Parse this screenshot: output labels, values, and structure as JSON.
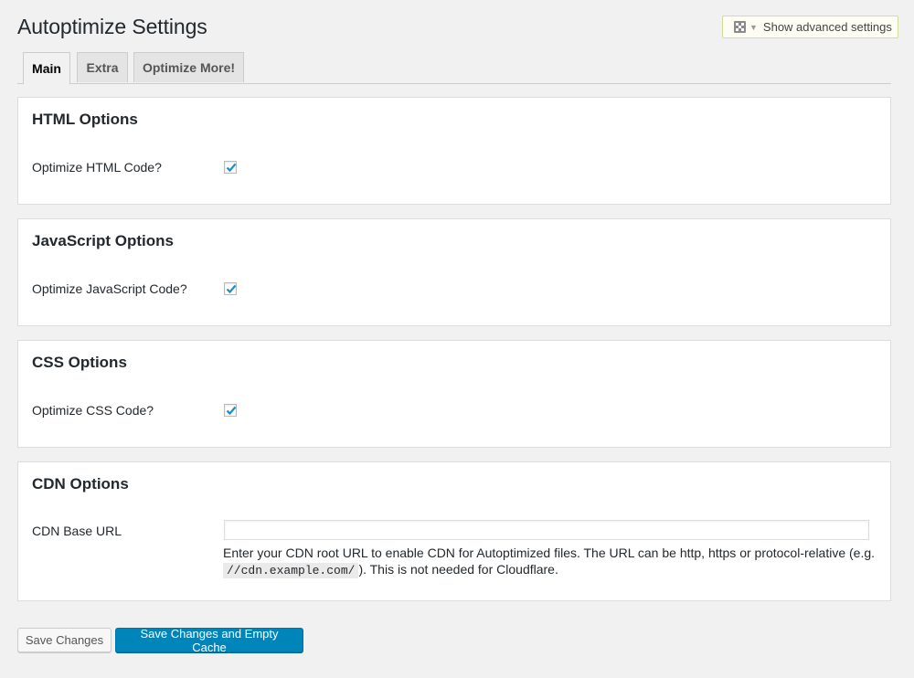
{
  "page": {
    "title": "Autoptimize Settings"
  },
  "advanced_toggle": {
    "label": "Show advanced settings",
    "icon": "settings-grid-icon"
  },
  "tabs": [
    {
      "label": "Main",
      "active": true
    },
    {
      "label": "Extra",
      "active": false
    },
    {
      "label": "Optimize More!",
      "active": false
    }
  ],
  "sections": {
    "html": {
      "heading": "HTML Options",
      "label": "Optimize HTML Code?",
      "checked": true
    },
    "js": {
      "heading": "JavaScript Options",
      "label": "Optimize JavaScript Code?",
      "checked": true
    },
    "css": {
      "heading": "CSS Options",
      "label": "Optimize CSS Code?",
      "checked": true
    },
    "cdn": {
      "heading": "CDN Options",
      "label": "CDN Base URL",
      "value": "",
      "help_before": "Enter your CDN root URL to enable CDN for Autoptimized files. The URL can be http, https or protocol-relative (e.g. ",
      "help_code": "//cdn.example.com/",
      "help_after": "). This is not needed for Cloudflare."
    }
  },
  "buttons": {
    "save": "Save Changes",
    "save_empty": "Save Changes and Empty Cache"
  },
  "colors": {
    "primary": "#0085ba",
    "checkmark": "#1e8cbe",
    "background": "#f1f1f1"
  }
}
